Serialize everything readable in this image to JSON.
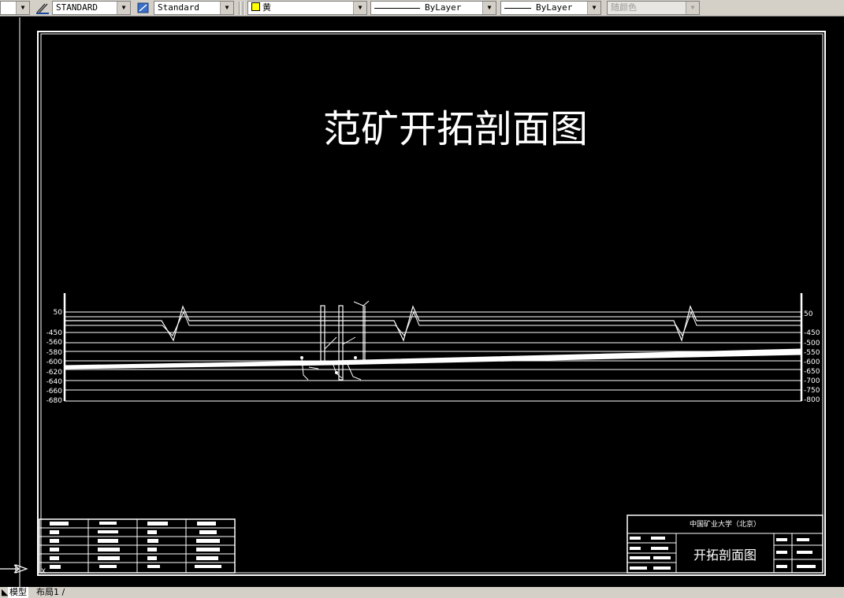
{
  "toolbar": {
    "text_style": "STANDARD",
    "dim_style": "Standard",
    "layer": "黄",
    "linetype": "ByLayer",
    "lineweight": "ByLayer",
    "plot_color": "随颜色"
  },
  "drawing": {
    "title": "范矿开拓剖面图",
    "left_elevations": [
      "50",
      "-450",
      "-560",
      "-580",
      "-600",
      "-620",
      "-640",
      "-660",
      "-680"
    ],
    "right_elevations": [
      "50",
      "-450",
      "-500",
      "-550",
      "-600",
      "-650",
      "-700",
      "-750",
      "-800"
    ],
    "title_block": {
      "school": "中国矿业大学（北京）",
      "drawing_name": "开拓剖面图"
    }
  },
  "tabs": {
    "model": "模型",
    "layout": "布局1"
  },
  "colors": {
    "background": "#000000",
    "lines": "#ffffff",
    "toolbar": "#d4d0c8",
    "layer_color": "#ffff00"
  },
  "icons": [
    "text-style-icon",
    "dim-style-icon",
    "ucs-icon",
    "layer-color-swatch"
  ]
}
